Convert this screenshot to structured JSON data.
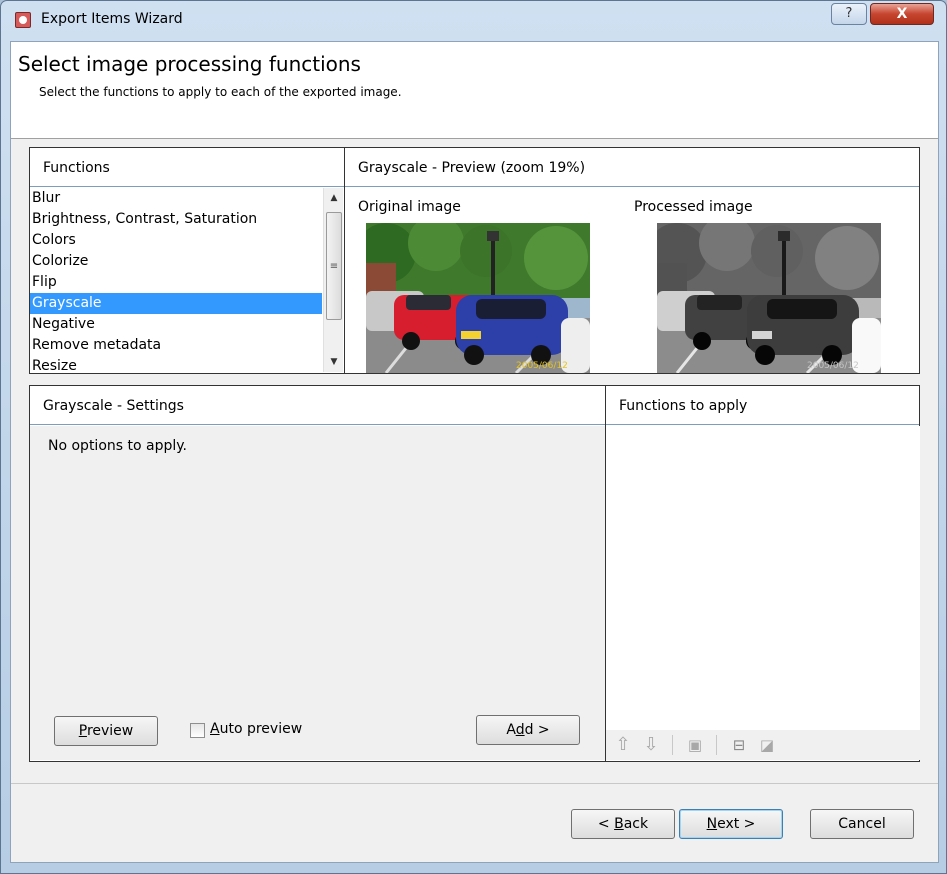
{
  "window": {
    "title": "Export Items Wizard",
    "help_label": "?",
    "close_label": "X"
  },
  "header": {
    "title": "Select image processing functions",
    "subtitle": "Select the functions to apply to each of the exported image."
  },
  "functions_panel": {
    "heading": "Functions",
    "items": [
      {
        "label": "Blur",
        "selected": false
      },
      {
        "label": "Brightness, Contrast, Saturation",
        "selected": false
      },
      {
        "label": "Colors",
        "selected": false
      },
      {
        "label": "Colorize",
        "selected": false
      },
      {
        "label": "Flip",
        "selected": false
      },
      {
        "label": "Grayscale",
        "selected": true
      },
      {
        "label": "Negative",
        "selected": false
      },
      {
        "label": "Remove metadata",
        "selected": false
      },
      {
        "label": "Resize",
        "selected": false
      }
    ]
  },
  "preview_panel": {
    "heading": "Grayscale - Preview (zoom 19%)",
    "original_label": "Original image",
    "processed_label": "Processed image",
    "photo_date": "2005/06/12"
  },
  "settings_panel": {
    "heading": "Grayscale - Settings",
    "message": "No options to apply.",
    "preview_button": {
      "prefix": "",
      "accel": "P",
      "rest": "review"
    },
    "auto_preview": {
      "prefix": "",
      "accel": "A",
      "rest": "uto preview",
      "checked": false
    },
    "add_button": {
      "prefix": "A",
      "accel": "d",
      "rest": "d >"
    }
  },
  "apply_panel": {
    "heading": "Functions to apply",
    "items": []
  },
  "footer": {
    "back_button": {
      "prefix": "< ",
      "accel": "B",
      "rest": "ack"
    },
    "next_button": {
      "prefix": "",
      "accel": "N",
      "rest": "ext >"
    },
    "cancel_label": "Cancel"
  },
  "colors": {
    "selection": "#3399ff",
    "panel_border": "#333333",
    "header_divider": "#7b9ebd"
  }
}
